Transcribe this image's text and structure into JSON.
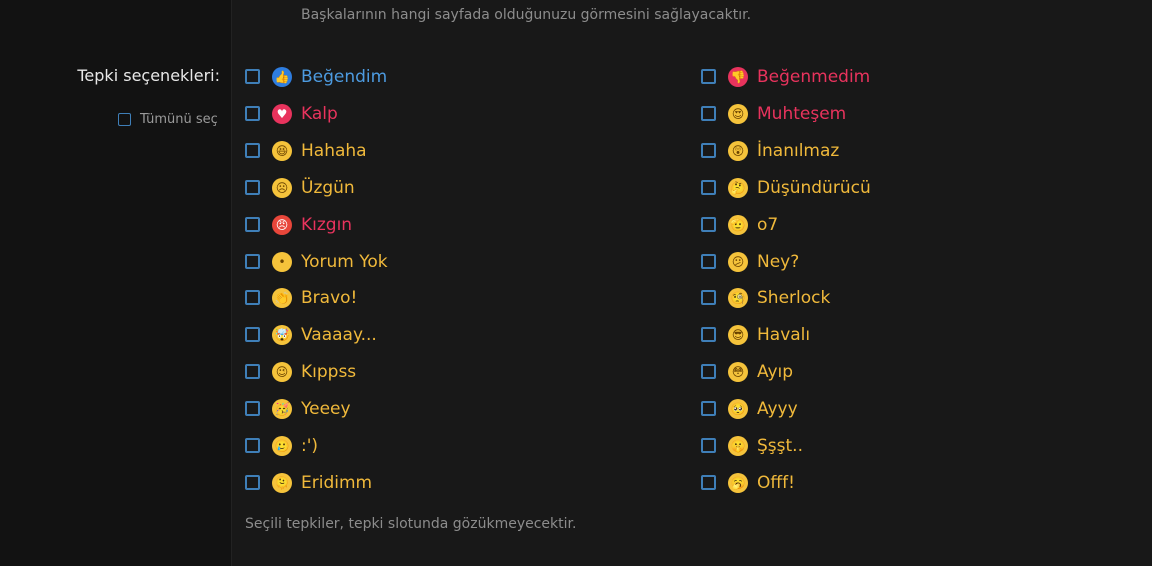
{
  "top_description": "Başkalarının hangi sayfada olduğunuzu görmesini sağlayacaktır.",
  "reactions_label": "Tepki seçenekleri:",
  "select_all_label": "Tümünü seç",
  "footer_note": "Seçili tepkiler, tepki slotunda gözükmeyecektir.",
  "reactions_left": [
    {
      "label": "Beğendim",
      "icon": "thumbs-up-icon",
      "glyph": "👍",
      "color": "#4d9be0",
      "bg": "#2e7de0"
    },
    {
      "label": "Kalp",
      "icon": "heart-icon",
      "glyph": "♥",
      "color": "#e8335d",
      "bg": "#e8335d"
    },
    {
      "label": "Hahaha",
      "icon": "laughing-emoji-icon",
      "glyph": "😆",
      "color": "#f0b93b",
      "bg": "#f5c33b"
    },
    {
      "label": "Üzgün",
      "icon": "sad-emoji-icon",
      "glyph": "☹",
      "color": "#f0b93b",
      "bg": "#f5c33b"
    },
    {
      "label": "Kızgın",
      "icon": "angry-emoji-icon",
      "glyph": "😠",
      "color": "#e8335d",
      "bg": "#e8463a"
    },
    {
      "label": "Yorum Yok",
      "icon": "no-mouth-emoji-icon",
      "glyph": "•",
      "color": "#f0b93b",
      "bg": "#f5c33b"
    },
    {
      "label": "Bravo!",
      "icon": "clapping-hands-icon",
      "glyph": "👏",
      "color": "#f0b93b",
      "bg": "#f5c33b"
    },
    {
      "label": "Vaaaay...",
      "icon": "mind-blown-emoji-icon",
      "glyph": "🤯",
      "color": "#f0b93b",
      "bg": "#f5c33b"
    },
    {
      "label": "Kıppss",
      "icon": "winking-emoji-icon",
      "glyph": "😉",
      "color": "#f0b93b",
      "bg": "#f5c33b"
    },
    {
      "label": "Yeeey",
      "icon": "party-emoji-icon",
      "glyph": "🥳",
      "color": "#f0b93b",
      "bg": "#f5c33b"
    },
    {
      "label": ":')",
      "icon": "tearful-smile-emoji-icon",
      "glyph": "🥲",
      "color": "#f0b93b",
      "bg": "#f5c33b"
    },
    {
      "label": "Eridimm",
      "icon": "melting-emoji-icon",
      "glyph": "🫠",
      "color": "#f0b93b",
      "bg": "#f5c33b"
    }
  ],
  "reactions_right": [
    {
      "label": "Beğenmedim",
      "icon": "thumbs-down-icon",
      "glyph": "👎",
      "color": "#e8335d",
      "bg": "#e8335d"
    },
    {
      "label": "Muhteşem",
      "icon": "heart-eyes-emoji-icon",
      "glyph": "😍",
      "color": "#e8335d",
      "bg": "#f5c33b"
    },
    {
      "label": "İnanılmaz",
      "icon": "astonished-emoji-icon",
      "glyph": "😲",
      "color": "#f0b93b",
      "bg": "#f5c33b"
    },
    {
      "label": "Düşündürücü",
      "icon": "thinking-emoji-icon",
      "glyph": "🤔",
      "color": "#f0b93b",
      "bg": "#f5c33b"
    },
    {
      "label": "o7",
      "icon": "saluting-emoji-icon",
      "glyph": "🫡",
      "color": "#f0b93b",
      "bg": "#f5c33b"
    },
    {
      "label": "Ney?",
      "icon": "confused-emoji-icon",
      "glyph": "😕",
      "color": "#f0b93b",
      "bg": "#f5c33b"
    },
    {
      "label": "Sherlock",
      "icon": "monocle-emoji-icon",
      "glyph": "🧐",
      "color": "#f0b93b",
      "bg": "#f5c33b"
    },
    {
      "label": "Havalı",
      "icon": "sunglasses-emoji-icon",
      "glyph": "😎",
      "color": "#f0b93b",
      "bg": "#f5c33b"
    },
    {
      "label": "Ayıp",
      "icon": "flushed-emoji-icon",
      "glyph": "😳",
      "color": "#f0b93b",
      "bg": "#f5c33b"
    },
    {
      "label": "Ayyy",
      "icon": "pleading-emoji-icon",
      "glyph": "🥺",
      "color": "#f0b93b",
      "bg": "#f5c33b"
    },
    {
      "label": "Şşşt..",
      "icon": "shushing-emoji-icon",
      "glyph": "🤫",
      "color": "#f0b93b",
      "bg": "#f5c33b"
    },
    {
      "label": "Offf!",
      "icon": "yawning-emoji-icon",
      "glyph": "🥱",
      "color": "#f0b93b",
      "bg": "#f5c33b"
    }
  ]
}
